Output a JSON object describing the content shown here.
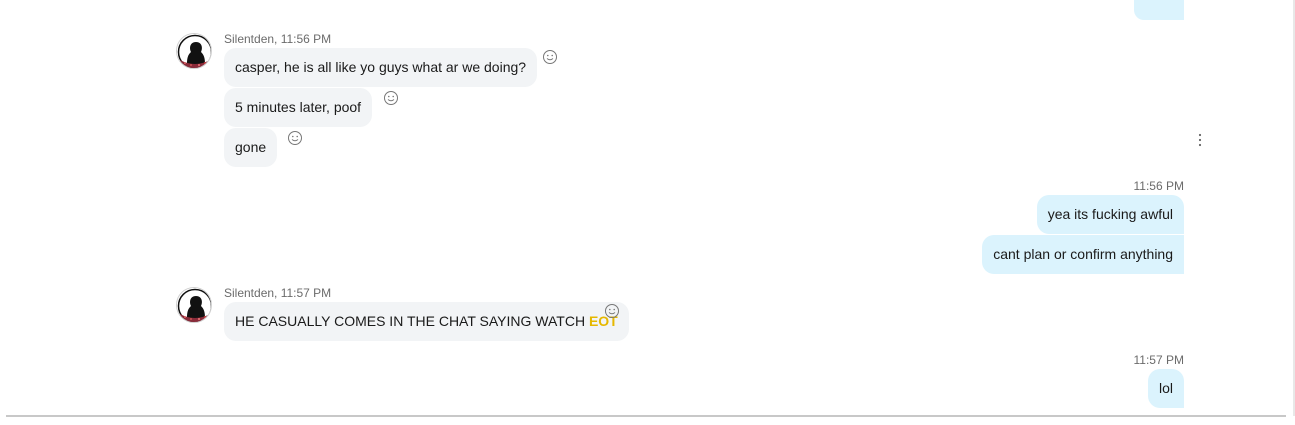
{
  "messages": [
    {
      "sender": "Silentden",
      "time": "11:56 PM",
      "meta": "Silentden, 11:56 PM",
      "lines": [
        "casper, he is all like yo guys what ar we doing?",
        "5 minutes later, poof",
        "gone"
      ]
    },
    {
      "sender": "me",
      "time": "11:56 PM",
      "lines": [
        "yea its fucking awful",
        "cant plan or confirm anything"
      ]
    },
    {
      "sender": "Silentden",
      "time": "11:57 PM",
      "meta": "Silentden, 11:57 PM",
      "text_prefix": "HE CASUALLY COMES IN THE CHAT SAYING WATCH ",
      "highlight": "EOT"
    },
    {
      "sender": "me",
      "time": "11:57 PM",
      "lines": [
        "lol"
      ]
    }
  ],
  "icons": {
    "reaction": "smiley-icon",
    "more": "more-vertical-icon",
    "avatar": "avatar-silhouette"
  },
  "colors": {
    "incoming_bubble": "#f2f4f6",
    "outgoing_bubble": "#dbf3fd",
    "highlight": "#e6b800",
    "meta_text": "#6b6b6b"
  }
}
